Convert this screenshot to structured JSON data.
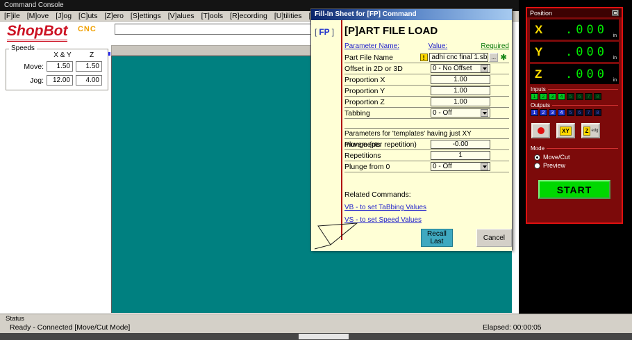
{
  "app": {
    "title": "Command Console"
  },
  "menu": {
    "items": [
      "[F]ile",
      "[M]ove",
      "[J]og",
      "[C]uts",
      "[Z]ero",
      "[S]ettings",
      "[V]alues",
      "[T]ools",
      "[R]ecording",
      "[U]tilities",
      "[H]elp"
    ]
  },
  "logo": {
    "brand": "ShopBot",
    "cnc": "CNC"
  },
  "command_input": {
    "value": ""
  },
  "speeds": {
    "title": "Speeds",
    "col_xy": "X & Y",
    "col_z": "Z",
    "move_label": "Move:",
    "jog_label": "Jog:",
    "move_xy": "1.50",
    "move_z": "1.50",
    "jog_xy": "12.00",
    "jog_z": "4.00"
  },
  "status": {
    "label": "Status",
    "message": "Ready - Connected  [Move/Cut Mode]",
    "elapsed": "Elapsed: 00:00:05"
  },
  "dialog": {
    "title": "Fill-In Sheet for [FP] Command",
    "code": {
      "open": "[",
      "text": "FP",
      "close": "]"
    },
    "heading": "[P]ART FILE LOAD",
    "col_param": "Parameter Name:",
    "col_value": "Value:",
    "col_required": "Required",
    "warning_icon": "!",
    "browse_label": "...",
    "required_marker": "✱",
    "rows": [
      {
        "label": "Part File Name",
        "value": "adhi cnc final 1.sbp"
      },
      {
        "label": "Offset in 2D or 3D",
        "value": "0 - No Offset"
      },
      {
        "label": "Proportion X",
        "value": "1.00"
      },
      {
        "label": "Proportion Y",
        "value": "1.00"
      },
      {
        "label": "Proportion Z",
        "value": "1.00"
      },
      {
        "label": "Tabbing",
        "value": "0 - Off"
      }
    ],
    "section_title": "Parameters for 'templates' having just XY movements",
    "rows2": [
      {
        "label": "Plunge (per repetition)",
        "value": "-0.00"
      },
      {
        "label": "Repetitions",
        "value": "1"
      },
      {
        "label": "Plunge from 0",
        "value": "0 - Off"
      }
    ],
    "related_title": "Related Commands:",
    "related": [
      "VB - to set TaBbing Values",
      "VS - to set Speed Values"
    ],
    "recall_button": "Recall Last",
    "cancel_button": "Cancel"
  },
  "position": {
    "title": "Position",
    "axes": [
      {
        "name": "X",
        "value": ".000",
        "unit": "in"
      },
      {
        "name": "Y",
        "value": ".000",
        "unit": "in"
      },
      {
        "name": "Z",
        "value": ".000",
        "unit": "in"
      }
    ],
    "inputs_label": "Inputs",
    "outputs_label": "Outputs",
    "input_leds": [
      "1",
      "2",
      "3",
      "4",
      "5",
      "6",
      "7",
      "8"
    ],
    "output_leds": [
      "1",
      "2",
      "3",
      "4",
      "5",
      "6",
      "7",
      "8"
    ],
    "buttons": {
      "zero_xy": "XY",
      "zero_z": "Z",
      "edge": "edg"
    },
    "mode_label": "Mode",
    "mode_options": [
      {
        "label": "Move/Cut",
        "selected": true
      },
      {
        "label": "Preview",
        "selected": false
      }
    ],
    "start_label": "START"
  },
  "colors": {
    "canvas_teal": "#008080",
    "start_green": "#00d800",
    "link_blue": "#2222cc",
    "required_green": "#1c8a1c",
    "position_red": "#7c0a0a"
  }
}
